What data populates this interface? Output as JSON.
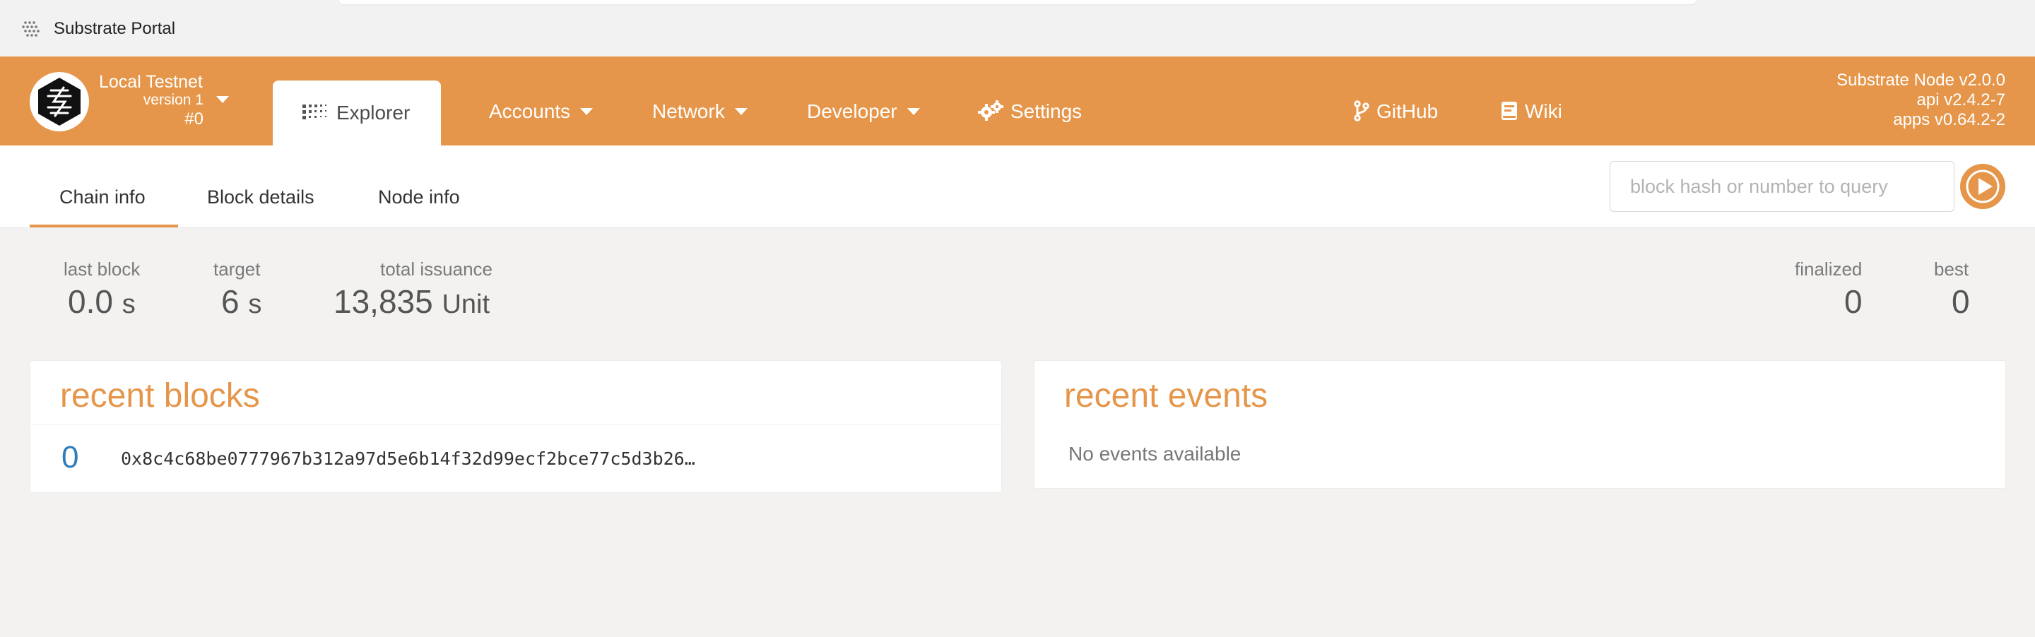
{
  "window": {
    "title": "Substrate Portal"
  },
  "nav": {
    "chain_name": "Local Testnet",
    "chain_version": "version 1",
    "chain_block": "#0",
    "explorer_label": "Explorer",
    "items": [
      {
        "label": "Accounts"
      },
      {
        "label": "Network"
      },
      {
        "label": "Developer"
      },
      {
        "label": "Settings"
      }
    ],
    "links": [
      {
        "label": "GitHub"
      },
      {
        "label": "Wiki"
      }
    ],
    "node_info": {
      "node": "Substrate Node v2.0.0",
      "api": "api v2.4.2-7",
      "apps": "apps v0.64.2-2"
    },
    "icons": {
      "explorer": "explorer-grid-icon",
      "settings": "gear-icon",
      "github": "branch-icon",
      "wiki": "book-icon"
    },
    "accent": "#e5964a"
  },
  "subnav": {
    "tabs": [
      "Chain info",
      "Block details",
      "Node info"
    ],
    "active_tab": "Chain info",
    "search_placeholder": "block hash or number to query"
  },
  "summary": {
    "last_block": {
      "label": "last block",
      "value": "0.0",
      "unit": "s"
    },
    "target": {
      "label": "target",
      "value": "6",
      "unit": "s"
    },
    "total_issuance": {
      "label": "total issuance",
      "value": "13,835",
      "unit": "Unit"
    },
    "finalized": {
      "label": "finalized",
      "value": "0"
    },
    "best": {
      "label": "best",
      "value": "0"
    }
  },
  "recent_blocks": {
    "title": "recent blocks",
    "rows": [
      {
        "number": "0",
        "hash": "0x8c4c68be0777967b312a97d5e6b14f32d99ecf2bce77c5d3b26…"
      }
    ]
  },
  "recent_events": {
    "title": "recent events",
    "empty_text": "No events available"
  }
}
